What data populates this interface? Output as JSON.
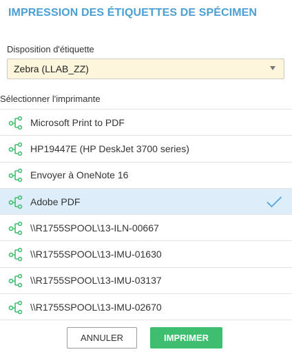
{
  "dialog": {
    "title": "IMPRESSION DES ÉTIQUETTES DE SPÉCIMEN"
  },
  "layout_field": {
    "label": "Disposition d'étiquette",
    "value": "Zebra (LLAB_ZZ)"
  },
  "printer_section": {
    "label": "Sélectionner l'imprimante",
    "items": [
      {
        "label": "Microsoft Print to PDF",
        "selected": false
      },
      {
        "label": "HP19447E (HP DeskJet 3700 series)",
        "selected": false
      },
      {
        "label": "Envoyer à OneNote 16",
        "selected": false
      },
      {
        "label": "Adobe PDF",
        "selected": true
      },
      {
        "label": "\\\\R1755SPOOL\\13-ILN-00667",
        "selected": false
      },
      {
        "label": "\\\\R1755SPOOL\\13-IMU-01630",
        "selected": false
      },
      {
        "label": "\\\\R1755SPOOL\\13-IMU-03137",
        "selected": false
      },
      {
        "label": "\\\\R1755SPOOL\\13-IMU-02670",
        "selected": false
      }
    ]
  },
  "buttons": {
    "cancel": "ANNULER",
    "print": "IMPRIMER"
  },
  "colors": {
    "title": "#4a9fd4",
    "icon": "#3dbf6f",
    "selected_row": "#ddeefa",
    "check": "#4a9fd4",
    "print_button": "#3dbf6f",
    "select_bg": "#fdf6dc"
  },
  "icons": {
    "printer_item": "network-tree-icon",
    "selected": "checkmark-icon",
    "dropdown": "chevron-down-icon"
  }
}
